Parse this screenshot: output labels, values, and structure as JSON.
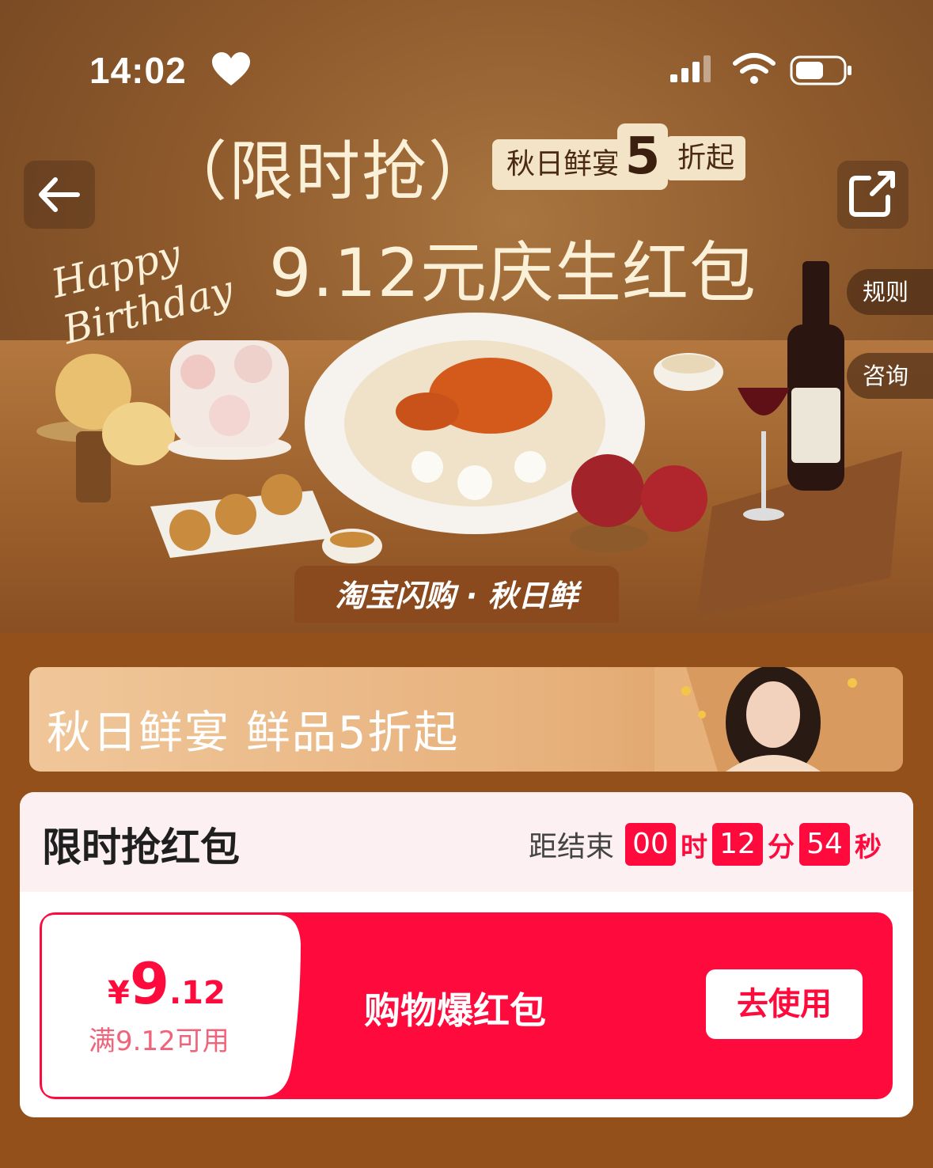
{
  "status_bar": {
    "time": "14:02"
  },
  "nav": {
    "rule_label": "规则",
    "consult_label": "咨询"
  },
  "hero": {
    "title": "（限时抢）",
    "tag_text": "秋日鲜宴",
    "tag_number": "5",
    "tag_tail": "折起",
    "subtitle": "9.12元庆生红包",
    "birthday_text": "Happy Birthday",
    "brand_label": "淘宝闪购 · 秋日鲜"
  },
  "sub_banner": {
    "title": "秋日鲜宴  鲜品5折起"
  },
  "flash_card": {
    "title": "限时抢红包",
    "countdown": {
      "label": "距结束",
      "hours": "00",
      "hours_unit": "时",
      "minutes": "12",
      "minutes_unit": "分",
      "seconds": "54",
      "seconds_unit": "秒"
    },
    "coupon": {
      "currency": "¥",
      "amount_int": "9",
      "amount_dec": ".12",
      "condition": "满9.12可用",
      "name": "购物爆红包",
      "button_label": "去使用"
    }
  },
  "colors": {
    "accent_red": "#ff0a3c",
    "page_bg": "#94501b",
    "card_head_bg": "#fdf0f2"
  },
  "icons": [
    "heart-icon",
    "signal-icon",
    "wifi-icon",
    "battery-icon",
    "back-arrow-icon",
    "share-icon"
  ]
}
